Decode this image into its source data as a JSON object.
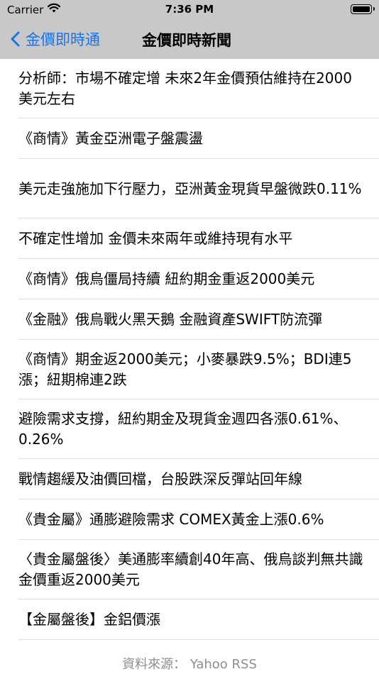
{
  "status_bar": {
    "carrier": "Carrier",
    "time": "7:36 PM"
  },
  "nav": {
    "back_label": "金價即時通",
    "title": "金價即時新聞"
  },
  "news": [
    {
      "title": "分析師：市場不確定增 未來2年金價預估維持在2000美元左右"
    },
    {
      "title": "《商情》黃金亞洲電子盤震盪"
    },
    {
      "title": "美元走強施加下行壓力，亞洲黃金現貨早盤微跌0.11%"
    },
    {
      "title": "不確定性增加 金價未來兩年或維持現有水平"
    },
    {
      "title": "《商情》俄烏僵局持續 紐約期金重返2000美元"
    },
    {
      "title": "《金融》俄烏戰火黑天鵝 金融資產SWIFT防流彈"
    },
    {
      "title": "《商情》期金返2000美元；小麥暴跌9.5%；BDI連5漲；紐期棉連2跌"
    },
    {
      "title": "避險需求支撐，紐約期金及現貨金週四各漲0.61%、0.26%"
    },
    {
      "title": "戰情趨緩及油價回檔，台股跌深反彈站回年線"
    },
    {
      "title": "《貴金屬》通膨避險需求 COMEX黃金上漲0.6%"
    },
    {
      "title": "〈貴金屬盤後〉美通膨率續創40年高、俄烏談判無共識 金價重返2000美元"
    },
    {
      "title": "【金屬盤後】金鋁價漲"
    }
  ],
  "footer": {
    "source": "資料來源：  Yahoo RSS"
  },
  "colors": {
    "header_bg": "#c8c8c8",
    "accent": "#1a73e8",
    "footer_text": "#8e8e93"
  },
  "icons": {
    "back": "chevron-left-icon",
    "wifi": "wifi-icon",
    "battery": "battery-icon"
  }
}
